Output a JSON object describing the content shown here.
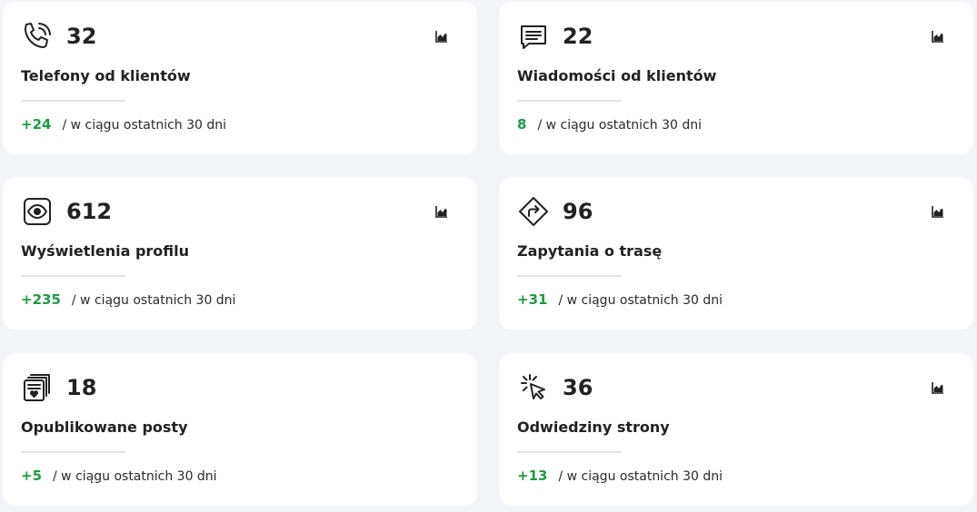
{
  "colors": {
    "background": "#f3f4f8",
    "card": "#ffffff",
    "positive": "#1f9a45",
    "text": "#222222"
  },
  "cards": [
    {
      "icon": "phone-icon",
      "count": "32",
      "label": "Telefony od klientów",
      "delta": "+24",
      "period": "/ w ciągu ostatnich 30 dni"
    },
    {
      "icon": "message-icon",
      "count": "22",
      "label": "Wiadomości od klientów",
      "delta": "8",
      "period": "/ w ciągu ostatnich 30 dni"
    },
    {
      "icon": "eye-icon",
      "count": "612",
      "label": "Wyświetlenia profilu",
      "delta": "+235",
      "period": "/ w ciągu ostatnich 30 dni"
    },
    {
      "icon": "directions-icon",
      "count": "96",
      "label": "Zapytania o trasę",
      "delta": "+31",
      "period": "/ w ciągu ostatnich 30 dni"
    },
    {
      "icon": "posts-icon",
      "count": "18",
      "label": "Opublikowane posty",
      "delta": "+5",
      "period": "/ w ciągu ostatnich 30 dni"
    },
    {
      "icon": "click-cursor-icon",
      "count": "36",
      "label": "Odwiedziny strony",
      "delta": "+13",
      "period": "/ w ciągu ostatnich 30 dni"
    }
  ]
}
